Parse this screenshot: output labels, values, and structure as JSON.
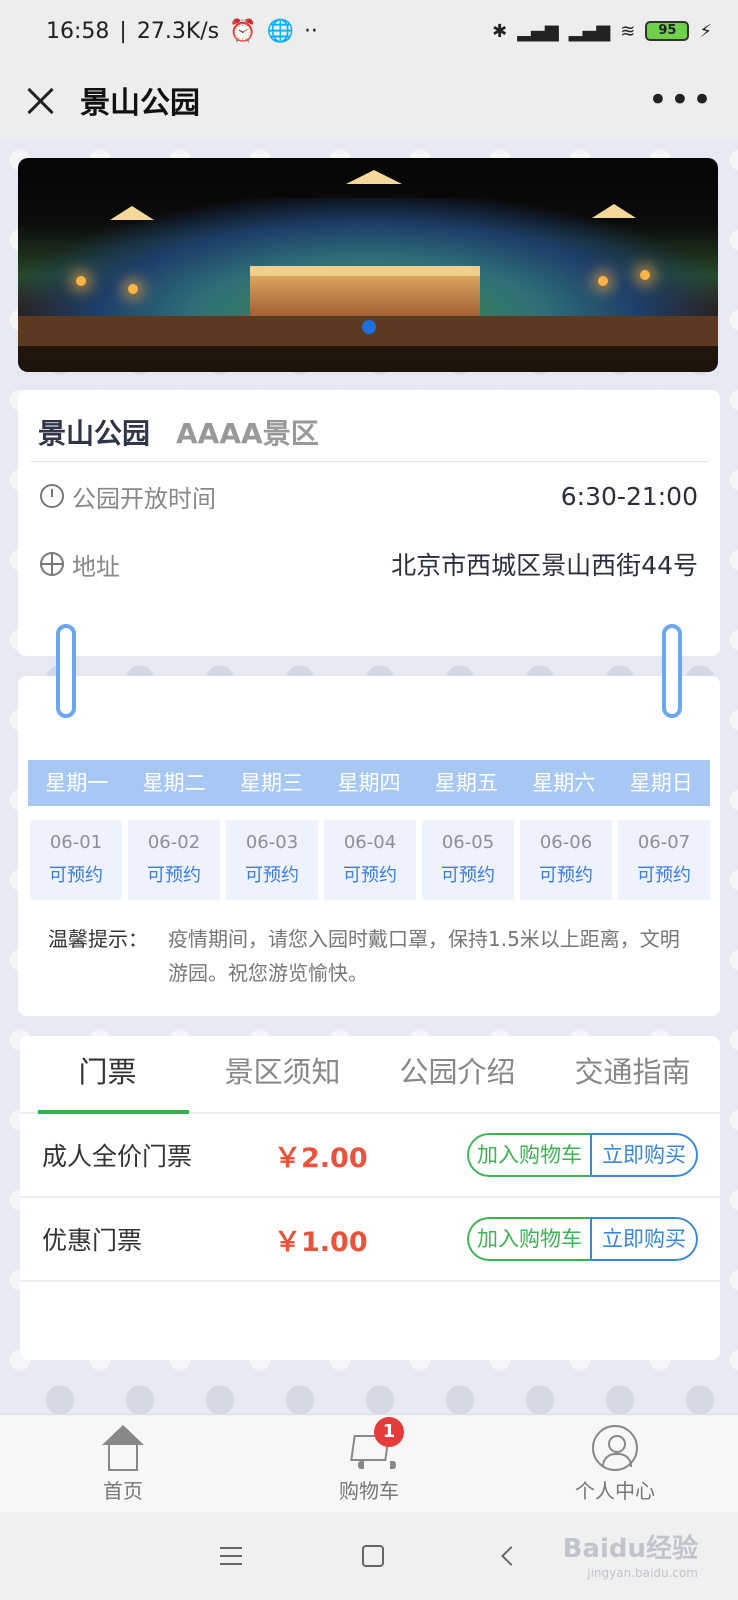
{
  "status_bar": {
    "time": "16:58",
    "net_speed": "27.3K/s",
    "battery": "95"
  },
  "header": {
    "title": "景山公园"
  },
  "park": {
    "name": "景山公园",
    "level": "AAAA景区",
    "hours_label": "公园开放时间",
    "hours_value": "6:30-21:00",
    "address_label": "地址",
    "address_value": "北京市西城区景山西街44号"
  },
  "calendar": {
    "weekdays": [
      "星期一",
      "星期二",
      "星期三",
      "星期四",
      "星期五",
      "星期六",
      "星期日"
    ],
    "days": [
      {
        "date": "06-01",
        "status": "可预约"
      },
      {
        "date": "06-02",
        "status": "可预约"
      },
      {
        "date": "06-03",
        "status": "可预约"
      },
      {
        "date": "06-04",
        "status": "可预约"
      },
      {
        "date": "06-05",
        "status": "可预约"
      },
      {
        "date": "06-06",
        "status": "可预约"
      },
      {
        "date": "06-07",
        "status": "可预约"
      }
    ],
    "tip_label": "温馨提示：",
    "tip_text": "疫情期间，请您入园时戴口罩，保持1.5米以上距离，文明游园。祝您游览愉快。"
  },
  "tabs": [
    "门票",
    "景区须知",
    "公园介绍",
    "交通指南"
  ],
  "tickets": [
    {
      "name": "成人全价门票",
      "price": "￥2.00",
      "cart_label": "加入购物车",
      "buy_label": "立即购买"
    },
    {
      "name": "优惠门票",
      "price": "￥1.00",
      "cart_label": "加入购物车",
      "buy_label": "立即购买"
    }
  ],
  "bottom_nav": {
    "home": "首页",
    "cart": "购物车",
    "cart_badge": "1",
    "profile": "个人中心"
  },
  "watermark": {
    "brand": "Baidu经验",
    "url": "jingyan.baidu.com"
  },
  "colors": {
    "accent_green": "#35b34a",
    "accent_blue": "#3a86d8",
    "price_red": "#e8543b",
    "weekday_bar": "#a8c8f4"
  }
}
